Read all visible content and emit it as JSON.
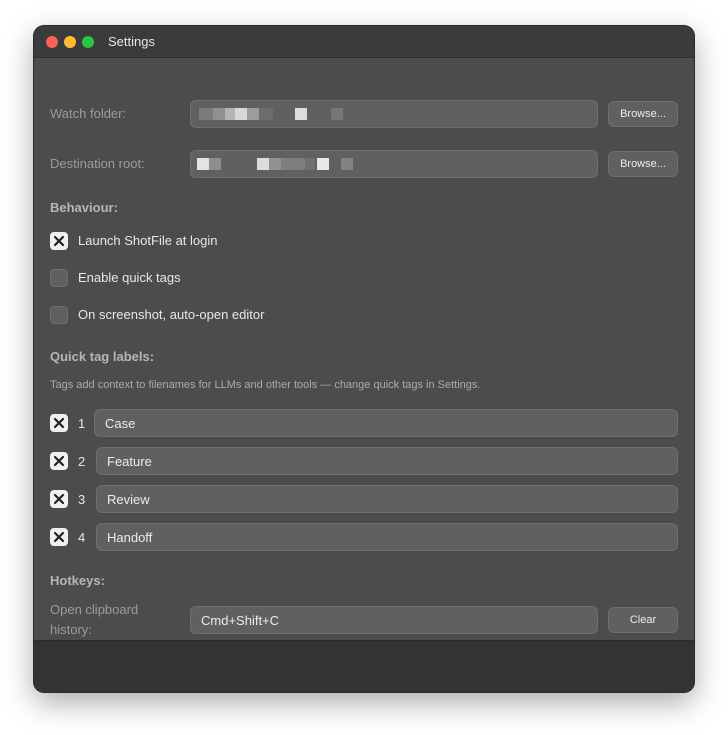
{
  "window": {
    "title": "Settings"
  },
  "watch_folder": {
    "label": "Watch folder:",
    "value": "",
    "browse_label": "Browse..."
  },
  "destination_root": {
    "label": "Destination root:",
    "value": "",
    "browse_label": "Browse..."
  },
  "behaviour": {
    "heading": "Behaviour:",
    "options": [
      {
        "label": "Launch ShotFile at login",
        "checked": true
      },
      {
        "label": "Enable quick tags",
        "checked": false
      },
      {
        "label": "On screenshot, auto-open editor",
        "checked": false
      }
    ]
  },
  "quick_tags": {
    "heading": "Quick tag labels:",
    "note": "Tags add context to filenames for LLMs and other tools — change quick tags in Settings.",
    "tags": [
      {
        "number": "1",
        "label": "Case",
        "checked": true
      },
      {
        "number": "2",
        "label": "Feature",
        "checked": true
      },
      {
        "number": "3",
        "label": "Review",
        "checked": true
      },
      {
        "number": "4",
        "label": "Handoff",
        "checked": true
      }
    ]
  },
  "hotkeys": {
    "heading": "Hotkeys:",
    "clipboard_label_line1": "Open clipboard",
    "clipboard_label_line2": "history:",
    "clipboard_value": "Cmd+Shift+C",
    "clear_label": "Clear"
  }
}
